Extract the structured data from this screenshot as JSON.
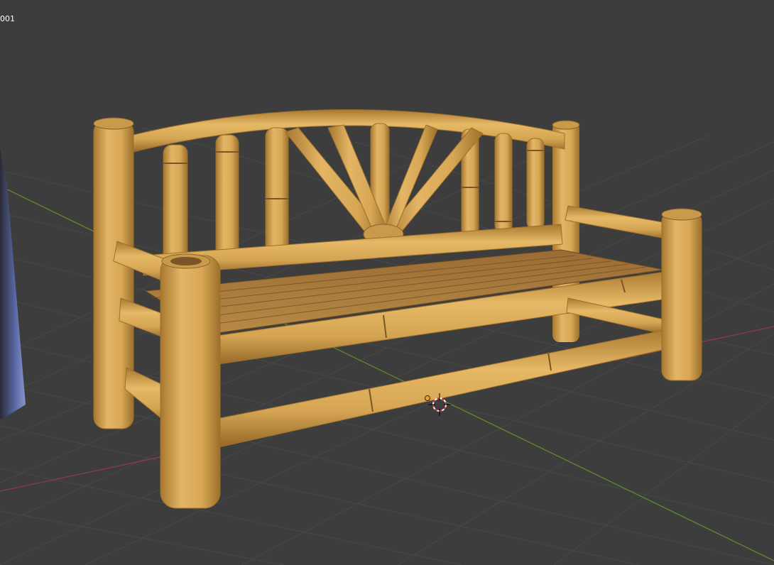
{
  "viewport": {
    "object_label": "001",
    "background_color": "#3d3d3d",
    "grid_color": "#484848",
    "x_axis_color": "#8f3b45",
    "y_axis_color": "#5f8a2e",
    "bamboo_color": "#d7a754",
    "bamboo_dark_color": "#a8782f",
    "seat_slat_color": "#8a6232"
  },
  "scene": {
    "object": "bamboo-bench",
    "side_object": "partial-mesh",
    "cursor": "3d-cursor-icon",
    "origin": "origin-point-icon"
  }
}
